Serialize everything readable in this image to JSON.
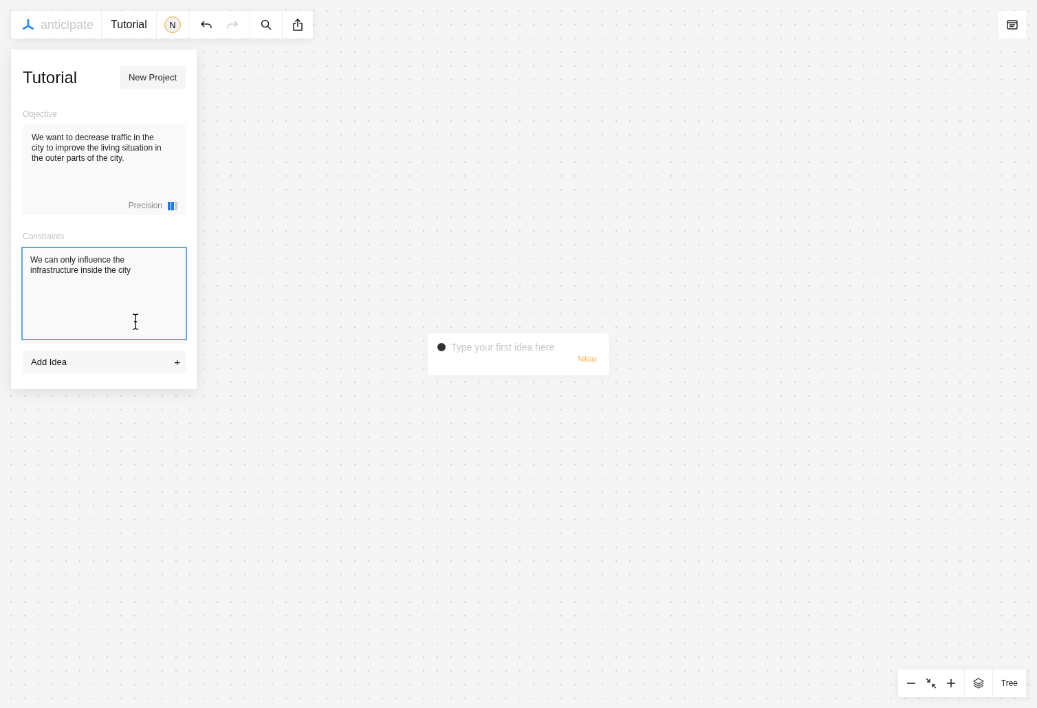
{
  "toolbar": {
    "app_name": "anticipate",
    "project": "Tutorial",
    "avatar": "N",
    "undo": {
      "disabled": false
    },
    "redo": {
      "disabled": true
    }
  },
  "panel": {
    "title": "Tutorial",
    "new_project": "New Project",
    "objective": {
      "label": "Objective",
      "value": "We want to decrease traffic in the city to improve the living situation in the outer parts of the city.",
      "precision_label": "Precision",
      "level": 0.67
    },
    "constraints": {
      "label": "Constraints",
      "value": "We can only influence the infrastructure inside the city",
      "focused": true
    },
    "add_idea": "Add Idea",
    "add_icon": "+"
  },
  "idea": {
    "placeholder": "Type your first idea here",
    "author": "Niklas"
  },
  "view_controls": {
    "view": "Tree"
  }
}
